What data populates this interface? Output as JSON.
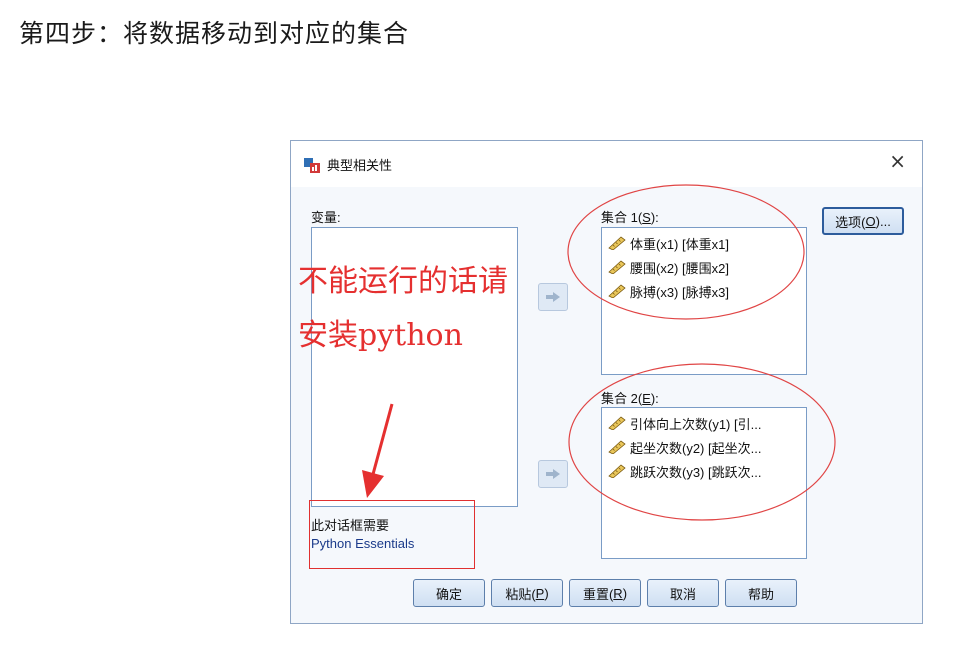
{
  "heading": "第四步：将数据移动到对应的集合",
  "dialog": {
    "title": "典型相关性",
    "close_glyph": "×",
    "variables_label": "变量:",
    "set1": {
      "label_prefix": "集合 1(",
      "label_key": "S",
      "label_suffix": "):",
      "items": [
        {
          "label": "体重(x1) [体重x1]"
        },
        {
          "label": "腰围(x2) [腰围x2]"
        },
        {
          "label": "脉搏(x3) [脉搏x3]"
        }
      ]
    },
    "set2": {
      "label_prefix": "集合 2(",
      "label_key": "E",
      "label_suffix": "):",
      "items": [
        {
          "label": "引体向上次数(y1) [引..."
        },
        {
          "label": "起坐次数(y2) [起坐次..."
        },
        {
          "label": "跳跃次数(y3) [跳跃次..."
        }
      ]
    },
    "options_button": {
      "prefix": "选项(",
      "key": "O",
      "suffix": ")..."
    },
    "note_line1": "此对话框需要",
    "note_line2": "Python Essentials",
    "buttons": {
      "ok": "确定",
      "paste_prefix": "粘贴(",
      "paste_key": "P",
      "paste_suffix": ")",
      "reset_prefix": "重置(",
      "reset_key": "R",
      "reset_suffix": ")",
      "cancel": "取消",
      "help": "帮助"
    }
  },
  "annotation": {
    "line1": "不能运行的话请",
    "line2": "安装python",
    "color": "#e53030"
  },
  "icons": {
    "variable": "ruler-icon",
    "arrow": "right-arrow-icon",
    "app": "spss-chart-icon"
  }
}
